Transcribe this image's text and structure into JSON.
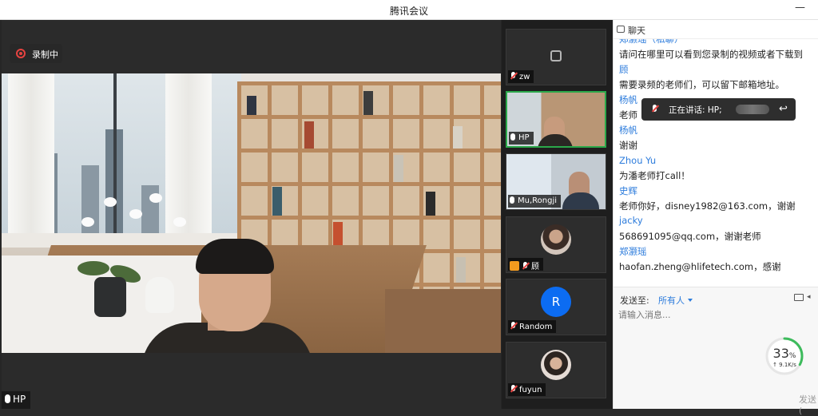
{
  "window": {
    "title": "腾讯会议",
    "minimize_glyph": "—"
  },
  "recording": {
    "label": "录制中",
    "icon": "record-dot-icon"
  },
  "main_speaker": {
    "name": "HP"
  },
  "participants": [
    {
      "name": "zw",
      "mic": "muted",
      "view": "placeholder"
    },
    {
      "name": "HP",
      "mic": "on",
      "view": "video",
      "active": true
    },
    {
      "name": "Mu,Rongji",
      "mic": "on",
      "view": "video"
    },
    {
      "name": "顾",
      "mic": "muted",
      "view": "avatar",
      "host": true
    },
    {
      "name": "Random",
      "mic": "muted",
      "view": "initial",
      "initial": "R"
    },
    {
      "name": "fuyun",
      "mic": "muted",
      "view": "avatar"
    }
  ],
  "chat": {
    "header": "聊天",
    "messages": [
      {
        "sender": "郑灏瑶（私聊）",
        "text": "请问在哪里可以看到您录制的视频或者下载到"
      },
      {
        "sender": "顾",
        "text": "需要录频的老师们，可以留下邮箱地址。"
      },
      {
        "sender": "杨帆",
        "text": "老师"
      },
      {
        "sender": "杨帆",
        "text": "谢谢"
      },
      {
        "sender": "Zhou Yu",
        "text": "为潘老师打call！"
      },
      {
        "sender": "史辉",
        "text": "老师你好，disney1982@163.com，谢谢"
      },
      {
        "sender": "jacky",
        "text": "568691095@qq.com，谢谢老师"
      },
      {
        "sender": "郑灏瑶",
        "text": "haofan.zheng@hlifetech.com，感谢"
      }
    ],
    "speaking_popup": "正在讲话: HP;",
    "send_to_label": "发送至:",
    "send_to_value": "所有人",
    "input_placeholder": "请输入消息...",
    "send_button": "发送("
  },
  "upload": {
    "percent": 33,
    "percent_text": "33",
    "unit": "%",
    "speed": "↑ 9.1K/s"
  },
  "colors": {
    "accent": "#2d7cdc",
    "record_red": "#e64340",
    "active_green": "#2ba84a",
    "avatar_blue": "#0c6cf2"
  }
}
